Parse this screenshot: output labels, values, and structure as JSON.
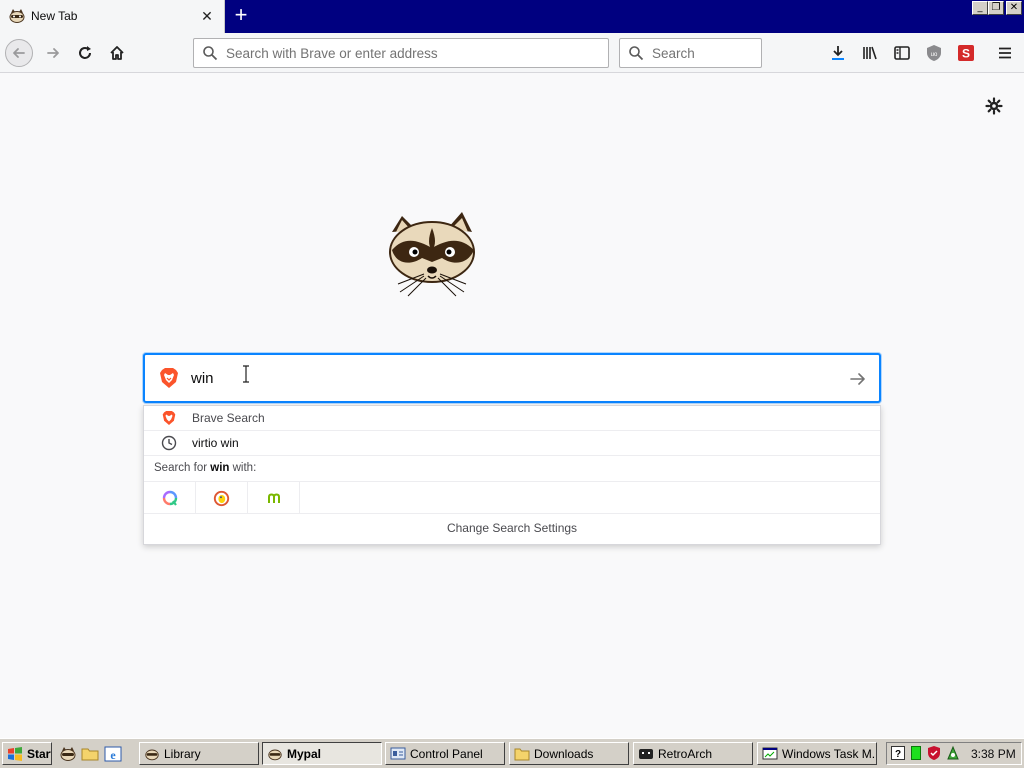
{
  "tab": {
    "title": "New Tab",
    "close_glyph": "✕"
  },
  "newtab_glyph": "+",
  "window_controls": [
    "_",
    "❐",
    "✕"
  ],
  "urlbar": {
    "placeholder": "Search with Brave or enter address"
  },
  "searchbar": {
    "placeholder": "Search"
  },
  "newtab_search": {
    "query": "win",
    "suggestions": [
      {
        "label": "Brave Search",
        "icon": "brave-icon"
      },
      {
        "label": "virtio win",
        "icon": "history-clock-icon"
      }
    ],
    "search_for_prefix": "Search for ",
    "search_for_term": "win",
    "search_for_suffix": " with:",
    "engines": [
      "qwant-icon",
      "duckduckgo-icon",
      "mojeek-icon"
    ],
    "change_settings_label": "Change Search Settings"
  },
  "toolbar_icons": [
    "download-icon",
    "library-icon",
    "sidebar-icon",
    "ublock-icon",
    "addon-s-icon",
    "menu-icon"
  ],
  "taskbar": {
    "start_label": "Start",
    "buttons": [
      {
        "label": "Library",
        "active": false
      },
      {
        "label": "Mypal",
        "active": true
      },
      {
        "label": "Control Panel",
        "active": false
      },
      {
        "label": "Downloads",
        "active": false
      },
      {
        "label": "RetroArch",
        "active": false
      },
      {
        "label": "Windows Task M...",
        "active": false
      }
    ],
    "clock": "3:38 PM"
  },
  "colors": {
    "accent": "#0a84ff",
    "titlebar": "#000080",
    "taskbar": "#d4d0c8"
  }
}
